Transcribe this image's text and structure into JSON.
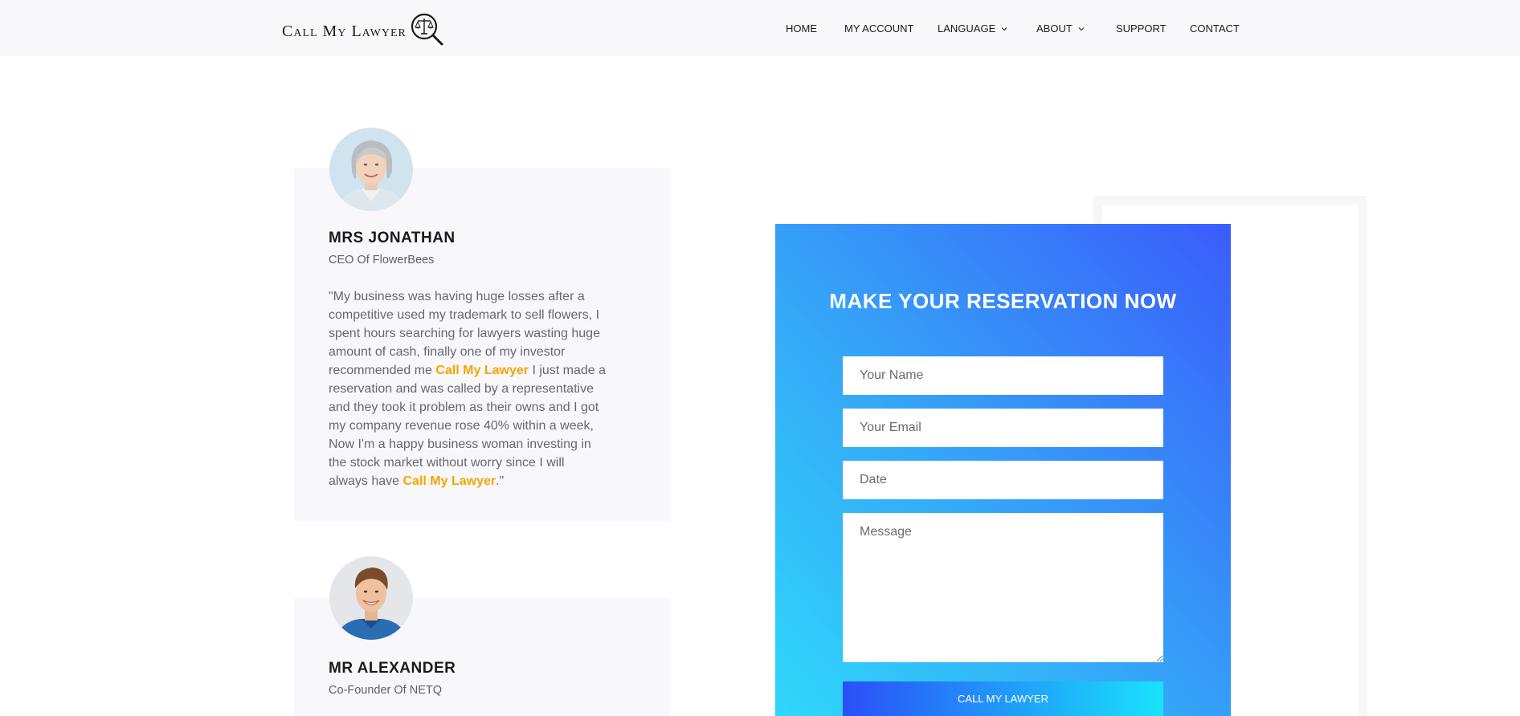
{
  "header": {
    "logo_text": "Call My Lawyer",
    "nav": [
      {
        "label": "HOME"
      },
      {
        "label": "MY ACCOUNT"
      },
      {
        "label": "LANGUAGE"
      },
      {
        "label": "ABOUT"
      },
      {
        "label": "SUPPORT"
      },
      {
        "label": "CONTACT"
      }
    ]
  },
  "testimonials": [
    {
      "name": "MRS JONATHAN",
      "role": "CEO Of FlowerBees",
      "quote_parts": [
        "\"My business was having huge losses after a competitive used my trademark to sell flowers, I spent hours searching for lawyers wasting huge amount of cash, finally one of my investor recommended me ",
        "Call My Lawyer",
        " I just made a reservation and was called by a representative and they took it problem as their owns and I got my company revenue rose 40% within a week, Now I'm a happy business woman investing in the stock market without worry since I will always have ",
        "Call My Lawyer",
        ".\""
      ]
    },
    {
      "name": "MR ALEXANDER",
      "role": "Co-Founder Of NETQ"
    }
  ],
  "reservation": {
    "title": "MAKE YOUR RESERVATION NOW",
    "name_placeholder": "Your Name",
    "email_placeholder": "Your Email",
    "date_placeholder": "Date",
    "message_placeholder": "Message",
    "submit_label": "CALL MY LAWYER"
  },
  "colors": {
    "highlight": "#f5a400",
    "form_gradient_start": "#2fd9fb",
    "form_gradient_end": "#3a5cfb"
  }
}
